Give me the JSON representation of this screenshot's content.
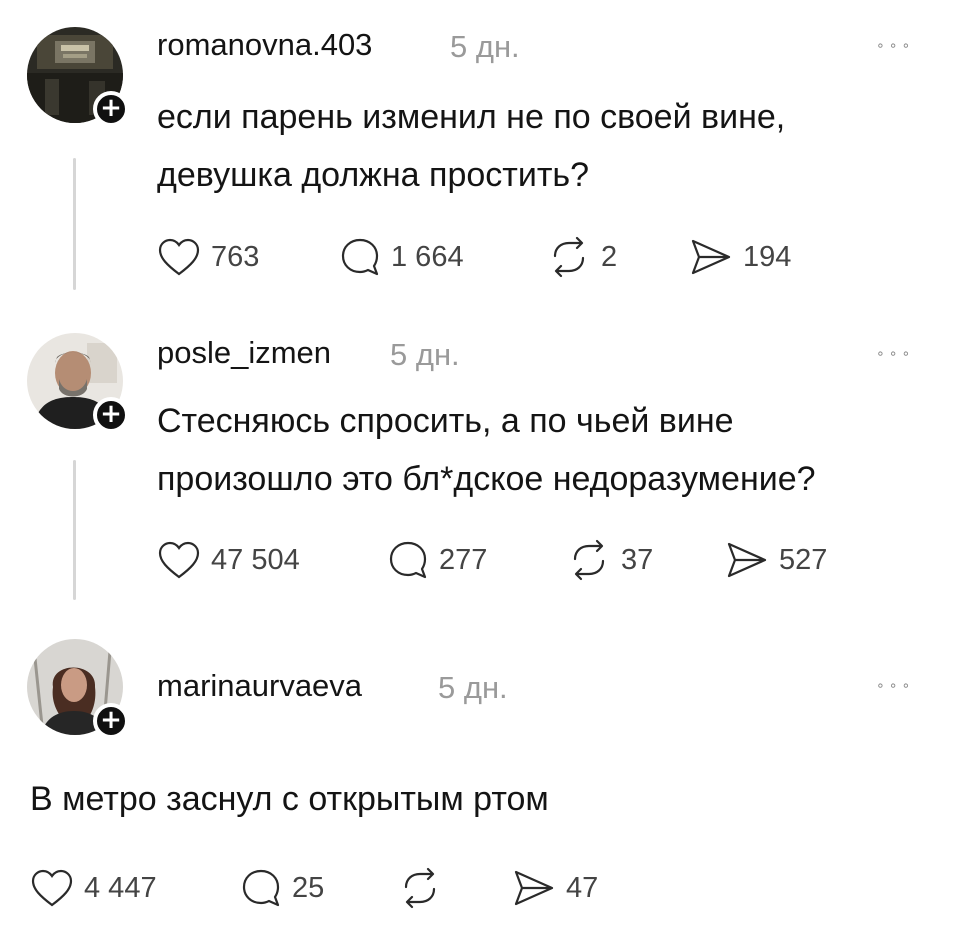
{
  "posts": [
    {
      "username": "romanovna.403",
      "time": "5 дн.",
      "more": "∘∘∘",
      "text": "если парень изменил не по своей вине,\nдевушка должна простить?",
      "likes": "763",
      "comments": "1 664",
      "reposts": "2",
      "shares": "194"
    },
    {
      "username": "posle_izmen",
      "time": "5 дн.",
      "more": "∘∘∘",
      "text": "Стесняюсь спросить, а по чьей вине\nпроизошло это бл*дское недоразумение?",
      "likes": "47 504",
      "comments": "277",
      "reposts": "37",
      "shares": "527"
    },
    {
      "username": "marinaurvaeva",
      "time": "5 дн.",
      "more": "∘∘∘",
      "text": "В метро заснул с открытым ртом",
      "likes": "4 447",
      "comments": "25",
      "reposts": "",
      "shares": "47"
    }
  ],
  "badge": "+",
  "icons": [
    "heart-icon",
    "comment-icon",
    "repost-icon",
    "share-icon",
    "more-icon",
    "plus-icon"
  ]
}
